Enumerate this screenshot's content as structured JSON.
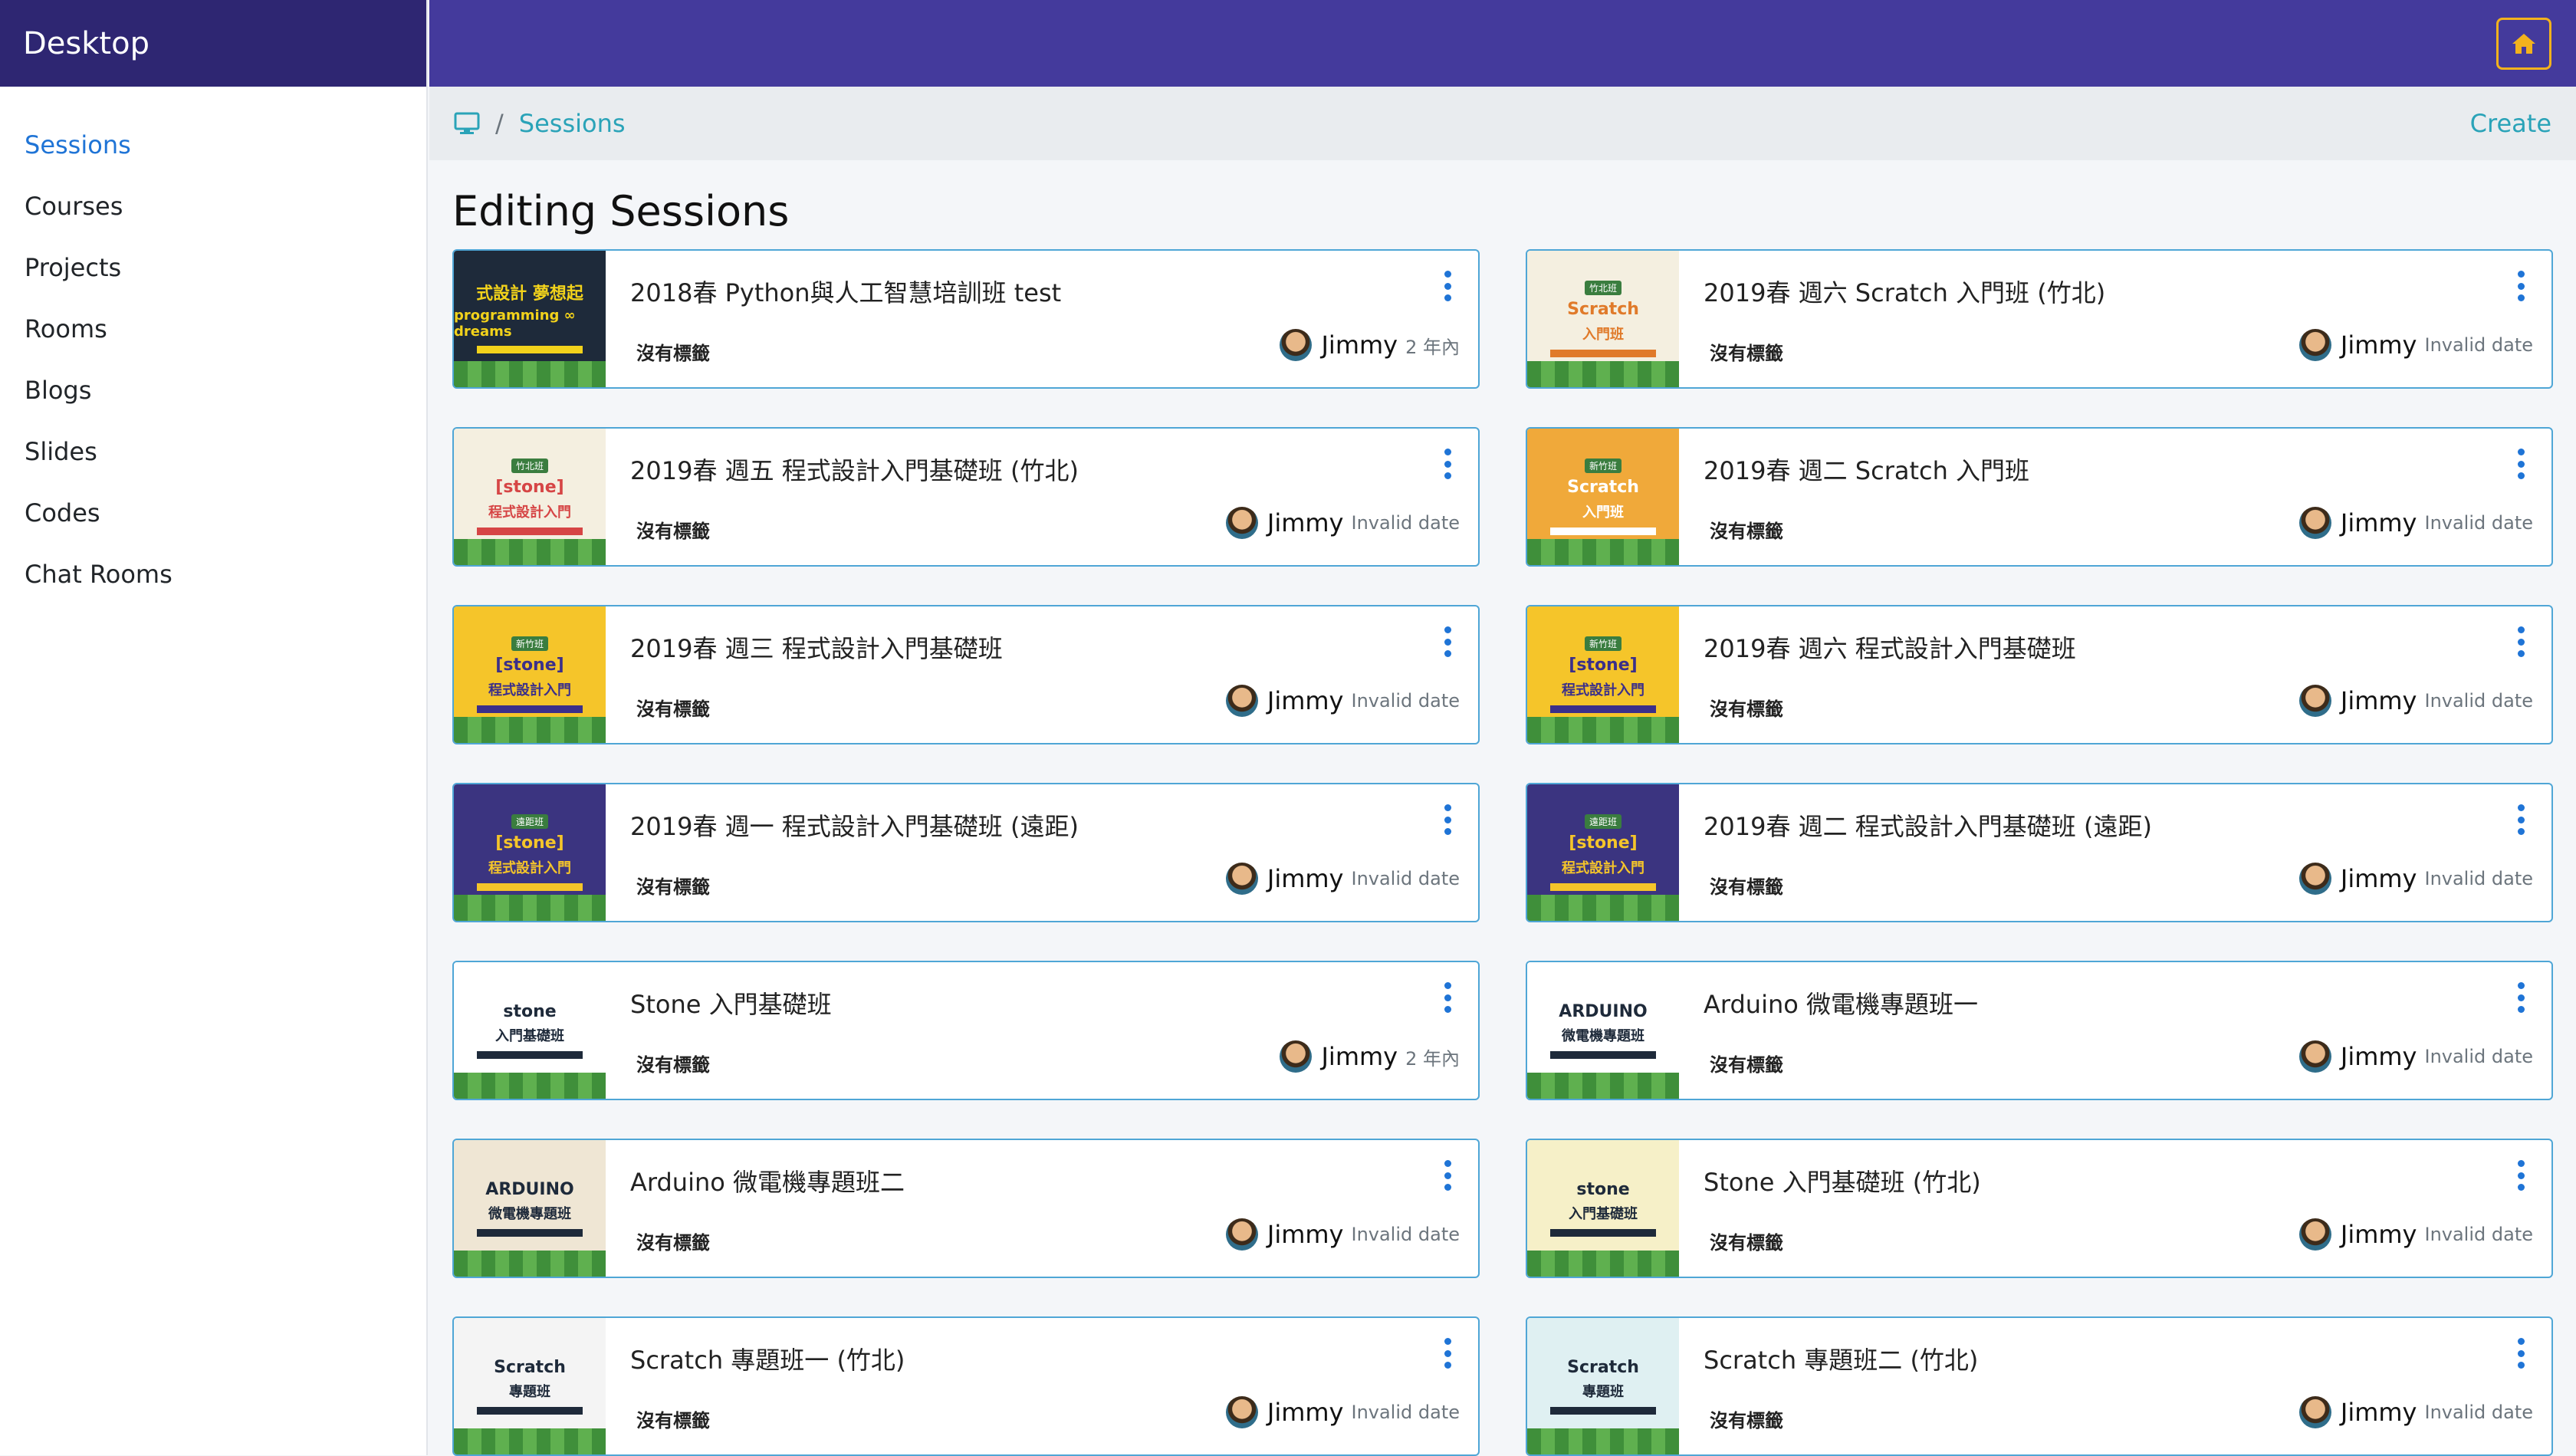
{
  "sidebar": {
    "brand": "Desktop",
    "items": [
      {
        "label": "Sessions",
        "active": true
      },
      {
        "label": "Courses"
      },
      {
        "label": "Projects"
      },
      {
        "label": "Rooms"
      },
      {
        "label": "Blogs"
      },
      {
        "label": "Slides"
      },
      {
        "label": "Codes"
      },
      {
        "label": "Chat Rooms"
      }
    ]
  },
  "topbar": {
    "home_icon": "home-icon",
    "accent": "#f3b21d",
    "bg": "#443a9c"
  },
  "breadcrumb": {
    "icon": "desktop-icon",
    "separator": "/",
    "current": "Sessions",
    "create_label": "Create"
  },
  "page": {
    "title": "Editing Sessions"
  },
  "cards": [
    {
      "title": "2018春 Python與人工智慧培訓班 test",
      "label": "沒有標籤",
      "author": "Jimmy",
      "date": "2 年內",
      "thumb": {
        "bg": "#1e2a3a",
        "fg": "#f2d21b",
        "t1": "式設計 夢想起",
        "t2": "programming ∞ dreams",
        "tag": ""
      }
    },
    {
      "title": "2019春 週六 Scratch 入門班 (竹北)",
      "label": "沒有標籤",
      "author": "Jimmy",
      "date": "Invalid date",
      "thumb": {
        "bg": "#f4efe0",
        "fg": "#e07a2a",
        "t1": "Scratch",
        "t2": "入門班",
        "tag": "竹北班"
      }
    },
    {
      "title": "2019春 週五 程式設計入門基礎班 (竹北)",
      "label": "沒有標籤",
      "author": "Jimmy",
      "date": "Invalid date",
      "thumb": {
        "bg": "#f4efe0",
        "fg": "#d64545",
        "t1": "[stone]",
        "t2": "程式設計入門",
        "tag": "竹北班"
      }
    },
    {
      "title": "2019春 週二 Scratch 入門班",
      "label": "沒有標籤",
      "author": "Jimmy",
      "date": "Invalid date",
      "thumb": {
        "bg": "#f0a93a",
        "fg": "#ffffff",
        "t1": "Scratch",
        "t2": "入門班",
        "tag": "新竹班"
      }
    },
    {
      "title": "2019春 週三 程式設計入門基礎班",
      "label": "沒有標籤",
      "author": "Jimmy",
      "date": "Invalid date",
      "thumb": {
        "bg": "#f5c52a",
        "fg": "#3b2f8a",
        "t1": "[stone]",
        "t2": "程式設計入門",
        "tag": "新竹班"
      }
    },
    {
      "title": "2019春 週六 程式設計入門基礎班",
      "label": "沒有標籤",
      "author": "Jimmy",
      "date": "Invalid date",
      "thumb": {
        "bg": "#f5c52a",
        "fg": "#3b2f8a",
        "t1": "[stone]",
        "t2": "程式設計入門",
        "tag": "新竹班"
      }
    },
    {
      "title": "2019春 週一 程式設計入門基礎班 (遠距)",
      "label": "沒有標籤",
      "author": "Jimmy",
      "date": "Invalid date",
      "thumb": {
        "bg": "#3b3480",
        "fg": "#f5c52a",
        "t1": "[stone]",
        "t2": "程式設計入門",
        "tag": "遠距班"
      }
    },
    {
      "title": "2019春 週二 程式設計入門基礎班 (遠距)",
      "label": "沒有標籤",
      "author": "Jimmy",
      "date": "Invalid date",
      "thumb": {
        "bg": "#3b3480",
        "fg": "#f5c52a",
        "t1": "[stone]",
        "t2": "程式設計入門",
        "tag": "遠距班"
      }
    },
    {
      "title": "Stone 入門基礎班",
      "label": "沒有標籤",
      "author": "Jimmy",
      "date": "2 年內",
      "thumb": {
        "bg": "#ffffff",
        "fg": "#1e2a3a",
        "t1": "stone",
        "t2": "入門基礎班",
        "tag": ""
      }
    },
    {
      "title": "Arduino 微電機專題班一",
      "label": "沒有標籤",
      "author": "Jimmy",
      "date": "Invalid date",
      "thumb": {
        "bg": "#ffffff",
        "fg": "#1e2a3a",
        "t1": "ARDUINO",
        "t2": "微電機專題班",
        "tag": ""
      }
    },
    {
      "title": "Arduino 微電機專題班二",
      "label": "沒有標籤",
      "author": "Jimmy",
      "date": "Invalid date",
      "thumb": {
        "bg": "#efe6d4",
        "fg": "#1e2a3a",
        "t1": "ARDUINO",
        "t2": "微電機專題班",
        "tag": ""
      }
    },
    {
      "title": "Stone 入門基礎班 (竹北)",
      "label": "沒有標籤",
      "author": "Jimmy",
      "date": "Invalid date",
      "thumb": {
        "bg": "#f6f0c8",
        "fg": "#1e2a3a",
        "t1": "stone",
        "t2": "入門基礎班",
        "tag": ""
      }
    },
    {
      "title": "Scratch 專題班一 (竹北)",
      "label": "沒有標籤",
      "author": "Jimmy",
      "date": "Invalid date",
      "thumb": {
        "bg": "#f4f4f4",
        "fg": "#1e2a3a",
        "t1": "Scratch",
        "t2": "專題班",
        "tag": ""
      }
    },
    {
      "title": "Scratch 專題班二 (竹北)",
      "label": "沒有標籤",
      "author": "Jimmy",
      "date": "Invalid date",
      "thumb": {
        "bg": "#dff0f2",
        "fg": "#1e2a3a",
        "t1": "Scratch",
        "t2": "專題班",
        "tag": ""
      }
    }
  ]
}
